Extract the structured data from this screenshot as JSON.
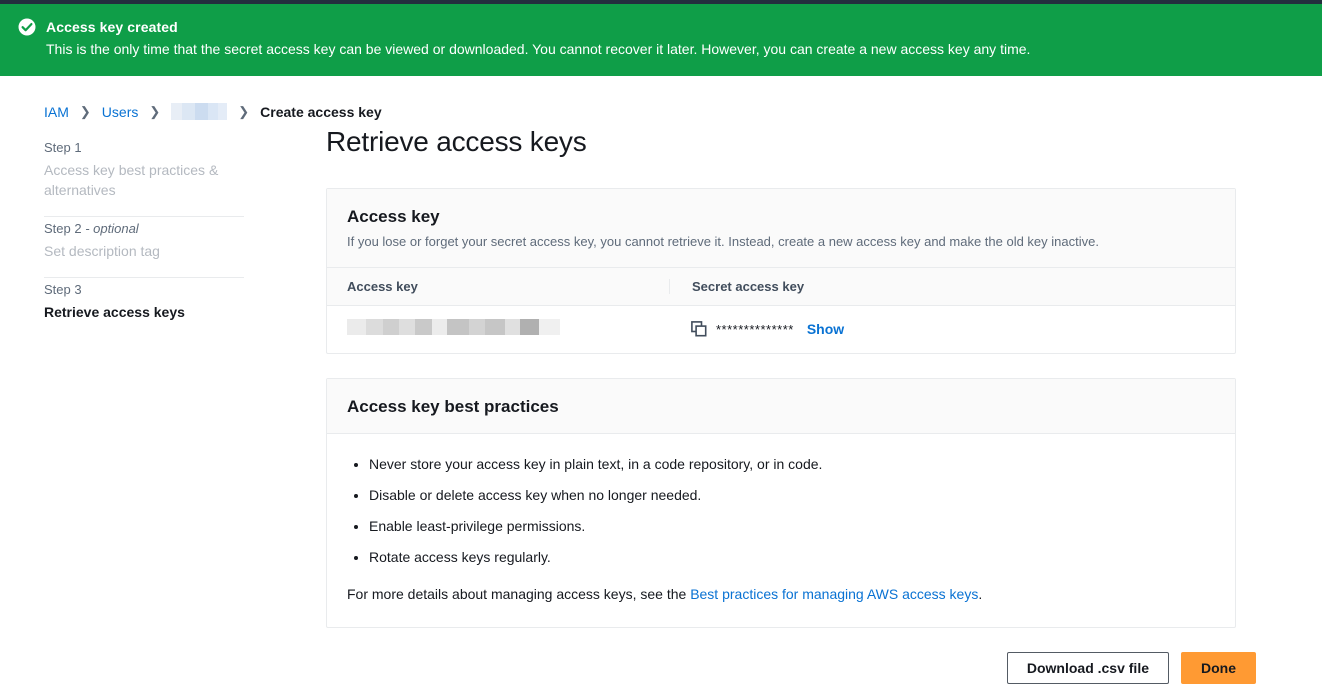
{
  "banner": {
    "icon": "check-circle-icon",
    "title": "Access key created",
    "description": "This is the only time that the secret access key can be viewed or downloaded. You cannot recover it later. However, you can create a new access key any time.",
    "color": "#0f9e48"
  },
  "breadcrumb": {
    "items": [
      {
        "label": "IAM",
        "type": "link"
      },
      {
        "label": "Users",
        "type": "link"
      },
      {
        "label": "",
        "type": "redacted"
      },
      {
        "label": "Create access key",
        "type": "current"
      }
    ],
    "separator": "›"
  },
  "sidebar": {
    "steps": [
      {
        "label": "Step 1",
        "optional": "",
        "name": "Access key best practices & alternatives",
        "active": false
      },
      {
        "label": "Step 2",
        "optional": "- optional",
        "name": "Set description tag",
        "active": false
      },
      {
        "label": "Step 3",
        "optional": "",
        "name": "Retrieve access keys",
        "active": true
      }
    ]
  },
  "main": {
    "title": "Retrieve access keys",
    "access_key_panel": {
      "title": "Access key",
      "description": "If you lose or forget your secret access key, you cannot retrieve it. Instead, create a new access key and make the old key inactive.",
      "columns": [
        "Access key",
        "Secret access key"
      ],
      "row": {
        "access_key_value": "",
        "copy_icon": "copy-icon",
        "secret_mask": "**************",
        "show_label": "Show"
      }
    },
    "best_practices_panel": {
      "title": "Access key best practices",
      "bullets": [
        "Never store your access key in plain text, in a code repository, or in code.",
        "Disable or delete access key when no longer needed.",
        "Enable least-privilege permissions.",
        "Rotate access keys regularly."
      ],
      "footer_prefix": "For more details about managing access keys, see the ",
      "footer_link": "Best practices for managing AWS access keys",
      "footer_suffix": "."
    }
  },
  "actions": {
    "download_label": "Download .csv file",
    "done_label": "Done",
    "primary_color": "#ff9a33"
  }
}
